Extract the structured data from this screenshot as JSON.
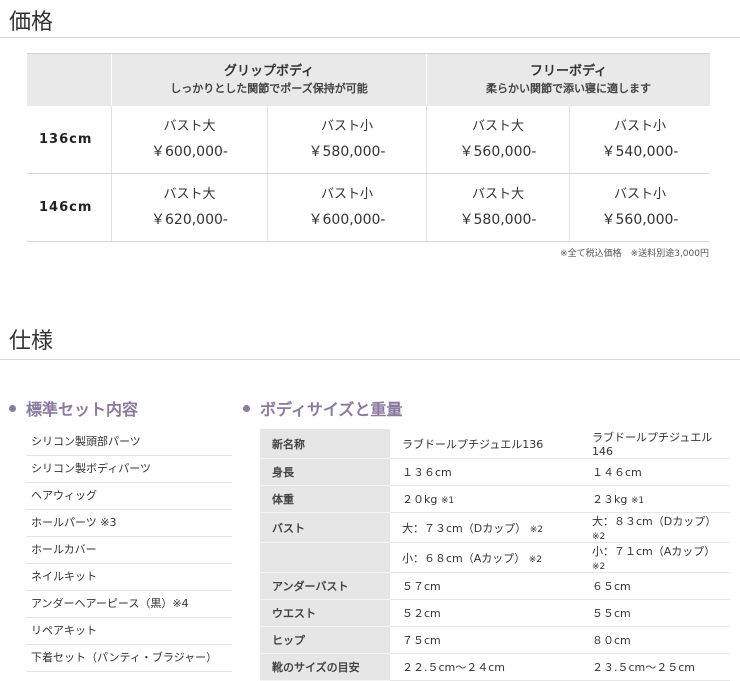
{
  "price": {
    "title": "価格",
    "groups": [
      {
        "name": "グリップボディ",
        "desc": "しっかりとした関節でポーズ保持が可能"
      },
      {
        "name": "フリーボディ",
        "desc": "柔らかい関節で添い寝に適します"
      }
    ],
    "rows": [
      {
        "size": "136cm",
        "cells": [
          {
            "bust": "バスト大",
            "price": "￥600,000-"
          },
          {
            "bust": "バスト小",
            "price": "￥580,000-"
          },
          {
            "bust": "バスト大",
            "price": "￥560,000-"
          },
          {
            "bust": "バスト小",
            "price": "￥540,000-"
          }
        ]
      },
      {
        "size": "146cm",
        "cells": [
          {
            "bust": "バスト大",
            "price": "￥620,000-"
          },
          {
            "bust": "バスト小",
            "price": "￥600,000-"
          },
          {
            "bust": "バスト大",
            "price": "￥580,000-"
          },
          {
            "bust": "バスト小",
            "price": "￥560,000-"
          }
        ]
      }
    ],
    "note": "※全て税込価格　※送料別途3,000円"
  },
  "spec": {
    "title": "仕様",
    "standard_set": {
      "title": "標準セット内容",
      "items": [
        "シリコン製頭部パーツ",
        "シリコン製ボディパーツ",
        "ヘアウィッグ",
        "ホールパーツ ※3",
        "ホールカバー",
        "ネイルキット",
        "アンダーヘアーピース（黒）※4",
        "リペアキット",
        "下着セット（パンティ・ブラジャー）"
      ]
    },
    "body": {
      "title": "ボディサイズと重量",
      "rows": [
        {
          "label": "新名称",
          "v1": "ラブドールプチジュエル136",
          "v2": "ラブドールプチジュエル146"
        },
        {
          "label": "身長",
          "v1": "１３６cm",
          "v2": "１４６cm"
        },
        {
          "label": "体重",
          "v1": "２０kg",
          "n1": "※1",
          "v2": "２３kg",
          "n2": "※1"
        },
        {
          "label": "バスト",
          "v1": "大：７３cm（Dカップ）",
          "n1": "※2",
          "v2": "大：８３cm（Dカップ）",
          "n2": "※2"
        },
        {
          "label": "",
          "v1": "小：６８cm（Aカップ）",
          "n1": "※2",
          "v2": "小：７１cm（Aカップ）",
          "n2": "※2"
        },
        {
          "label": "アンダーバスト",
          "v1": "５７cm",
          "v2": "６５cm"
        },
        {
          "label": "ウエスト",
          "v1": "５２cm",
          "v2": "５５cm"
        },
        {
          "label": "ヒップ",
          "v1": "７５cm",
          "v2": "８０cm"
        },
        {
          "label": "靴のサイズの目安",
          "v1": "２２.５cm〜２４cm",
          "v2": "２３.５cm〜２５cm"
        }
      ]
    }
  }
}
